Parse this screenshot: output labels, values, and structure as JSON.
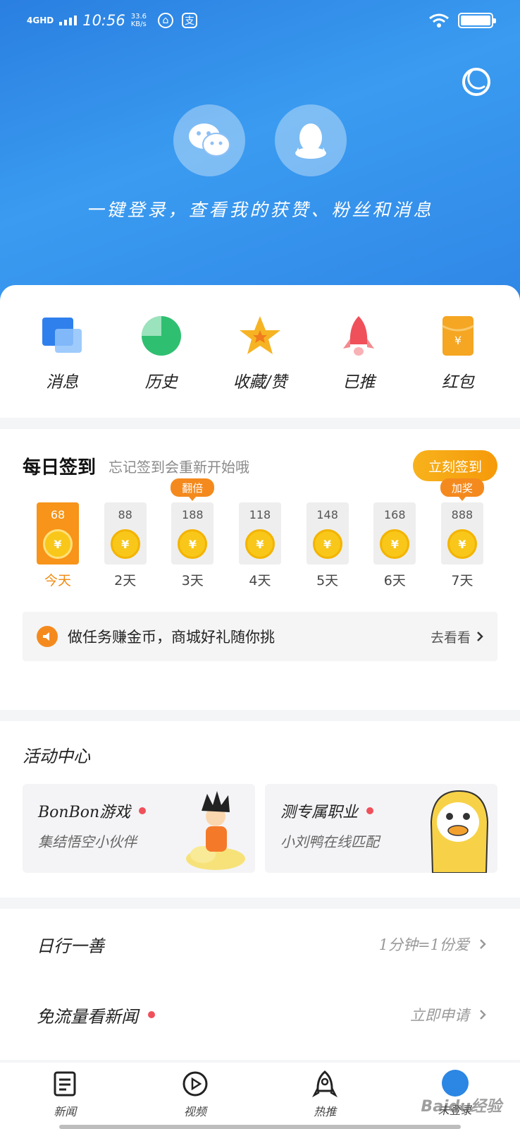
{
  "status_bar": {
    "network": "4GHD",
    "time": "10:56",
    "speed_value": "33.6",
    "speed_unit": "KB/s",
    "app_icon_label": "支"
  },
  "login": {
    "prompt": "一键登录，查看我的获赞、粉丝和消息",
    "wechat_icon": "wechat-icon",
    "qq_icon": "qq-icon"
  },
  "quick_menu": [
    {
      "label": "消息",
      "icon": "message-icon",
      "color": "#2f80ed"
    },
    {
      "label": "历史",
      "icon": "history-icon",
      "color": "#2fbf71"
    },
    {
      "label": "收藏/赞",
      "icon": "star-icon",
      "color": "#f6a623"
    },
    {
      "label": "已推",
      "icon": "rocket-icon",
      "color": "#f0505a"
    },
    {
      "label": "红包",
      "icon": "red-packet-icon",
      "color": "#f5a623"
    }
  ],
  "checkin": {
    "title": "每日签到",
    "subtitle": "忘记签到会重新开始哦",
    "button": "立刻签到",
    "days": [
      {
        "value": "68",
        "label": "今天",
        "tag": "",
        "today": true
      },
      {
        "value": "88",
        "label": "2天",
        "tag": ""
      },
      {
        "value": "188",
        "label": "3天",
        "tag": "翻倍"
      },
      {
        "value": "118",
        "label": "4天",
        "tag": ""
      },
      {
        "value": "148",
        "label": "5天",
        "tag": ""
      },
      {
        "value": "168",
        "label": "6天",
        "tag": ""
      },
      {
        "value": "888",
        "label": "7天",
        "tag": "加奖"
      }
    ],
    "coin_symbol": "¥",
    "task_text": "做任务赚金币，商城好礼随你挑",
    "task_link": "去看看"
  },
  "activity": {
    "title": "活动中心",
    "cards": [
      {
        "title": "BonBon游戏",
        "subtitle": "集结悟空小伙伴"
      },
      {
        "title": "测专属职业",
        "subtitle": "小刘鸭在线匹配"
      }
    ]
  },
  "list": [
    {
      "label": "日行一善",
      "value": "1分钟=1份爱",
      "dot": false
    },
    {
      "label": "免流量看新闻",
      "value": "立即申请",
      "dot": true
    }
  ],
  "tabbar": [
    {
      "label": "新闻",
      "icon": "news-icon"
    },
    {
      "label": "视频",
      "icon": "video-play-icon"
    },
    {
      "label": "热推",
      "icon": "rocket-icon"
    },
    {
      "label": "未登录",
      "icon": "avatar-icon"
    }
  ],
  "watermark": "Baidu经验",
  "colors": {
    "brand_blue": "#2f86e6",
    "orange": "#f79419",
    "red_dot": "#f0505a"
  }
}
